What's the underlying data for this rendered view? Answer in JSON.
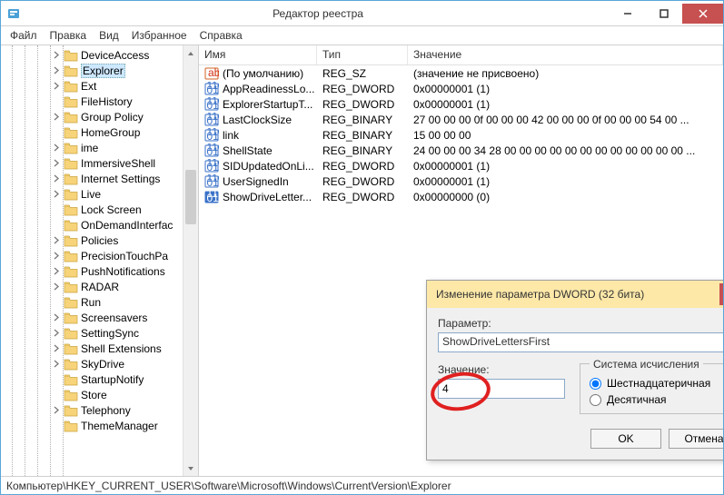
{
  "window": {
    "title": "Редактор реестра"
  },
  "menu": {
    "file": "Файл",
    "edit": "Правка",
    "view": "Вид",
    "favorites": "Избранное",
    "help": "Справка"
  },
  "tree": {
    "items": [
      {
        "label": "DeviceAccess",
        "expandable": true
      },
      {
        "label": "Explorer",
        "expandable": true,
        "selected": true
      },
      {
        "label": "Ext",
        "expandable": true
      },
      {
        "label": "FileHistory",
        "expandable": false
      },
      {
        "label": "Group Policy",
        "expandable": true
      },
      {
        "label": "HomeGroup",
        "expandable": false
      },
      {
        "label": "ime",
        "expandable": true
      },
      {
        "label": "ImmersiveShell",
        "expandable": true
      },
      {
        "label": "Internet Settings",
        "expandable": true
      },
      {
        "label": "Live",
        "expandable": true
      },
      {
        "label": "Lock Screen",
        "expandable": false
      },
      {
        "label": "OnDemandInterfac",
        "expandable": false
      },
      {
        "label": "Policies",
        "expandable": true
      },
      {
        "label": "PrecisionTouchPa",
        "expandable": true
      },
      {
        "label": "PushNotifications",
        "expandable": true
      },
      {
        "label": "RADAR",
        "expandable": true
      },
      {
        "label": "Run",
        "expandable": false
      },
      {
        "label": "Screensavers",
        "expandable": true
      },
      {
        "label": "SettingSync",
        "expandable": true
      },
      {
        "label": "Shell Extensions",
        "expandable": true
      },
      {
        "label": "SkyDrive",
        "expandable": true
      },
      {
        "label": "StartupNotify",
        "expandable": false
      },
      {
        "label": "Store",
        "expandable": false
      },
      {
        "label": "Telephony",
        "expandable": true
      },
      {
        "label": "ThemeManager",
        "expandable": false
      }
    ]
  },
  "list": {
    "col_name": "Имя",
    "col_type": "Тип",
    "col_value": "Значение",
    "rows": [
      {
        "icon": "sz",
        "name": "(По умолчанию)",
        "type": "REG_SZ",
        "value": "(значение не присвоено)"
      },
      {
        "icon": "bin",
        "name": "AppReadinessLo...",
        "type": "REG_DWORD",
        "value": "0x00000001 (1)"
      },
      {
        "icon": "bin",
        "name": "ExplorerStartupT...",
        "type": "REG_DWORD",
        "value": "0x00000001 (1)"
      },
      {
        "icon": "bin",
        "name": "LastClockSize",
        "type": "REG_BINARY",
        "value": "27 00 00 00 0f 00 00 00 42 00 00 00 0f 00 00 00 54 00 ..."
      },
      {
        "icon": "bin",
        "name": "link",
        "type": "REG_BINARY",
        "value": "15 00 00 00"
      },
      {
        "icon": "bin",
        "name": "ShellState",
        "type": "REG_BINARY",
        "value": "24 00 00 00 34 28 00 00 00 00 00 00 00 00 00 00 00 00 ..."
      },
      {
        "icon": "bin",
        "name": "SIDUpdatedOnLi...",
        "type": "REG_DWORD",
        "value": "0x00000001 (1)"
      },
      {
        "icon": "bin",
        "name": "UserSignedIn",
        "type": "REG_DWORD",
        "value": "0x00000001 (1)"
      },
      {
        "icon": "bin-sel",
        "name": "ShowDriveLetter...",
        "type": "REG_DWORD",
        "value": "0x00000000 (0)"
      }
    ]
  },
  "dialog": {
    "title": "Изменение параметра DWORD (32 бита)",
    "param_label": "Параметр:",
    "param_value": "ShowDriveLettersFirst",
    "value_label": "Значение:",
    "value_value": "4",
    "radix_legend": "Система исчисления",
    "radix_hex": "Шестнадцатеричная",
    "radix_dec": "Десятичная",
    "ok": "OK",
    "cancel": "Отмена"
  },
  "status": {
    "path": "Компьютер\\HKEY_CURRENT_USER\\Software\\Microsoft\\Windows\\CurrentVersion\\Explorer"
  }
}
